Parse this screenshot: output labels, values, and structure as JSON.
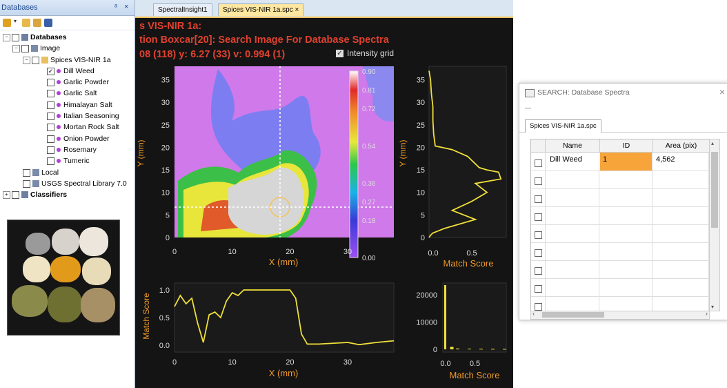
{
  "left_panel": {
    "title": "Databases",
    "pin": " ",
    "close": "×",
    "tree": {
      "root": "Databases",
      "image": "Image",
      "dataset": "Spices VIS-NIR 1a",
      "items": [
        "Dill Weed",
        "Garlic Powder",
        "Garlic Salt",
        "Himalayan Salt",
        "Italian Seasoning",
        "Mortan Rock Salt",
        "Onion Powder",
        "Rosemary",
        "Tumeric"
      ],
      "checked_item": "Dill Weed",
      "local": "Local",
      "usgs": "USGS Spectral Library 7.0",
      "classifiers": "Classifiers"
    }
  },
  "tabs": {
    "tab1": "SpectralInsight1",
    "tab2": "Spices VIS-NIR 1a.spc",
    "tab2_close": "×"
  },
  "header": {
    "line1": "s VIS-NIR 1a:",
    "line2": "tion Boxcar[20]: Search Image For Database Spectra",
    "line3": "08 (118)  y:  6.27 (33)  v:  0.994 (1)",
    "intensity_grid": "Intensity grid"
  },
  "image_plot": {
    "ylabel": "Y (mm)",
    "xlabel": "X (mm)",
    "yticks": [
      "35",
      "30",
      "25",
      "20",
      "15",
      "10",
      "5",
      "0"
    ],
    "xticks": [
      "0",
      "10",
      "20",
      "30"
    ],
    "colorbar_ticks": [
      "0.90",
      "0.81",
      "0.72",
      "0.54",
      "0.36",
      "0.27",
      "0.18",
      "0.00"
    ]
  },
  "right_profile": {
    "ylabel": "Y (mm)",
    "xlabel": "Match Score",
    "yticks": [
      "35",
      "30",
      "25",
      "20",
      "15",
      "10",
      "5",
      "0"
    ],
    "xticks": [
      "0.0",
      "0.5"
    ]
  },
  "bottom_profile": {
    "ylabel": "Match Score",
    "xlabel": "X (mm)",
    "yticks": [
      "1.0",
      "0.5",
      "0.0"
    ],
    "xticks": [
      "0",
      "10",
      "20",
      "30"
    ]
  },
  "histogram": {
    "xlabel": "Match Score",
    "yticks": [
      "20000",
      "10000",
      "0"
    ],
    "xticks": [
      "0.0",
      "0.5"
    ]
  },
  "search_dialog": {
    "title": "SEARCH: Database Spectra",
    "close": "×",
    "minimize": "—",
    "tab": "Spices VIS-NIR 1a.spc",
    "columns": [
      "Name",
      "ID",
      "Area (pix)"
    ],
    "rows": [
      {
        "name": "Dill Weed",
        "id": "1",
        "area": "4,562"
      }
    ],
    "highlight_color": "#f7a53a"
  },
  "chart_data": [
    {
      "type": "heatmap",
      "title": "",
      "xlabel": "X (mm)",
      "ylabel": "Y (mm)",
      "xlim": [
        0,
        38
      ],
      "ylim": [
        0,
        38
      ],
      "colorbar": {
        "min": 0.0,
        "max": 0.9,
        "ticks": [
          0.9,
          0.81,
          0.72,
          0.54,
          0.36,
          0.27,
          0.18,
          0.0
        ]
      },
      "crosshair": {
        "x": 18.08,
        "y": 6.27
      }
    },
    {
      "type": "line",
      "title": "",
      "xlabel": "Match Score",
      "ylabel": "Y (mm)",
      "xlim": [
        0,
        1
      ],
      "ylim": [
        0,
        38
      ],
      "x": [
        0.0,
        0.02,
        0.03,
        0.05,
        0.05,
        0.06,
        0.08,
        0.3,
        0.5,
        0.65,
        0.75,
        0.9,
        0.93,
        0.6,
        0.75,
        0.55,
        0.3,
        0.6,
        0.2,
        0.05,
        0.02,
        0.0
      ],
      "y": [
        37,
        35,
        32,
        29,
        26,
        23,
        20.3,
        19.5,
        18,
        15.5,
        15,
        14.5,
        13,
        12,
        10,
        8,
        6,
        4,
        2,
        1,
        0.5,
        0
      ]
    },
    {
      "type": "line",
      "title": "",
      "xlabel": "X (mm)",
      "ylabel": "Match Score",
      "xlim": [
        0,
        38
      ],
      "ylim": [
        0,
        1.05
      ],
      "x": [
        0,
        1,
        2,
        3,
        4,
        5,
        6,
        7,
        8,
        9,
        10,
        11,
        12,
        14,
        16,
        18,
        20,
        21,
        22,
        23,
        25,
        30,
        32,
        35,
        38
      ],
      "y": [
        0.7,
        0.9,
        0.75,
        0.85,
        0.4,
        0.05,
        0.55,
        0.6,
        0.5,
        0.8,
        0.95,
        0.9,
        1.0,
        1.0,
        1.0,
        1.0,
        1.0,
        0.85,
        0.2,
        0.02,
        0.02,
        0.05,
        0.01,
        0.05,
        0.08
      ]
    },
    {
      "type": "bar",
      "title": "",
      "xlabel": "Match Score",
      "ylabel": "",
      "xlim": [
        0,
        1
      ],
      "ylim": [
        0,
        24000
      ],
      "x": [
        0.0,
        0.1,
        0.2,
        0.4,
        0.6,
        0.8,
        1.0
      ],
      "values": [
        23500,
        900,
        300,
        250,
        200,
        180,
        150
      ]
    }
  ]
}
